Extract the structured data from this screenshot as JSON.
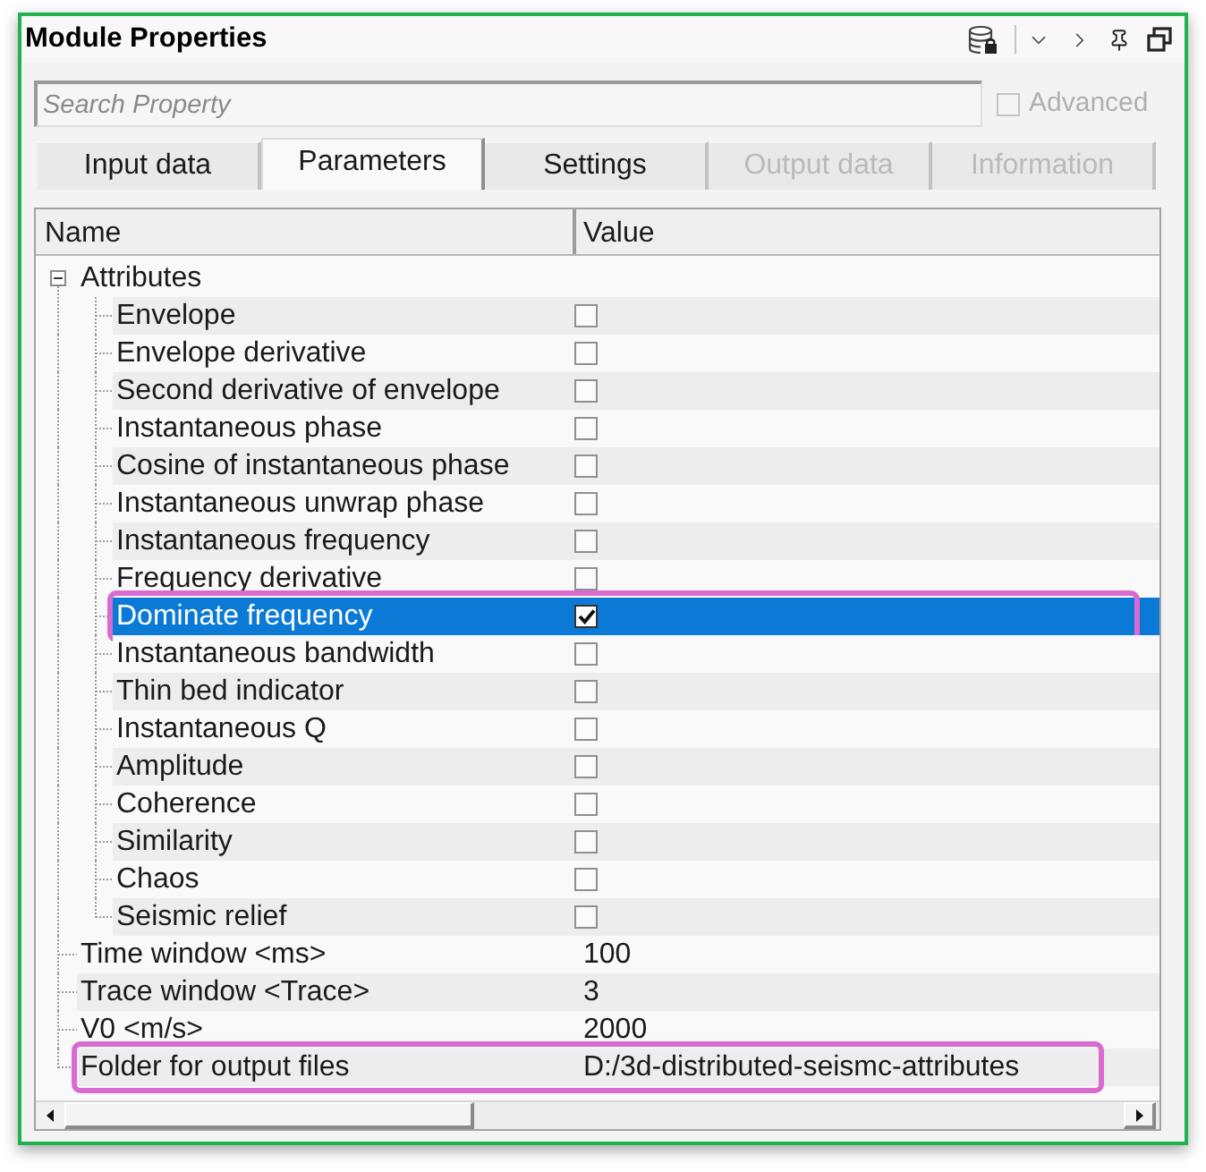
{
  "window": {
    "title": "Module Properties"
  },
  "search": {
    "placeholder": "Search Property"
  },
  "advanced": {
    "label": "Advanced",
    "checked": false,
    "disabled": true
  },
  "tabs": [
    {
      "label": "Input data",
      "selected": false,
      "disabled": false
    },
    {
      "label": "Parameters",
      "selected": true,
      "disabled": false
    },
    {
      "label": "Settings",
      "selected": false,
      "disabled": false
    },
    {
      "label": "Output data",
      "selected": false,
      "disabled": true
    },
    {
      "label": "Information",
      "selected": false,
      "disabled": true
    }
  ],
  "table": {
    "columns": [
      "Name",
      "Value"
    ],
    "rows": [
      {
        "name": "Attributes",
        "kind": "group",
        "expanded": true,
        "selected": false,
        "highlighted": false,
        "children": [
          {
            "name": "Envelope",
            "kind": "checkbox",
            "checked": false,
            "selected": false,
            "highlighted": false
          },
          {
            "name": "Envelope derivative",
            "kind": "checkbox",
            "checked": false,
            "selected": false,
            "highlighted": false
          },
          {
            "name": "Second derivative of envelope",
            "kind": "checkbox",
            "checked": false,
            "selected": false,
            "highlighted": false
          },
          {
            "name": "Instantaneous phase",
            "kind": "checkbox",
            "checked": false,
            "selected": false,
            "highlighted": false
          },
          {
            "name": "Cosine of instantaneous phase",
            "kind": "checkbox",
            "checked": false,
            "selected": false,
            "highlighted": false
          },
          {
            "name": "Instantaneous unwrap phase",
            "kind": "checkbox",
            "checked": false,
            "selected": false,
            "highlighted": false
          },
          {
            "name": "Instantaneous frequency",
            "kind": "checkbox",
            "checked": false,
            "selected": false,
            "highlighted": false
          },
          {
            "name": "Frequency derivative",
            "kind": "checkbox",
            "checked": false,
            "selected": false,
            "highlighted": false
          },
          {
            "name": "Dominate frequency",
            "kind": "checkbox",
            "checked": true,
            "selected": true,
            "highlighted": true
          },
          {
            "name": "Instantaneous bandwidth",
            "kind": "checkbox",
            "checked": false,
            "selected": false,
            "highlighted": false
          },
          {
            "name": "Thin bed indicator",
            "kind": "checkbox",
            "checked": false,
            "selected": false,
            "highlighted": false
          },
          {
            "name": "Instantaneous Q",
            "kind": "checkbox",
            "checked": false,
            "selected": false,
            "highlighted": false
          },
          {
            "name": "Amplitude",
            "kind": "checkbox",
            "checked": false,
            "selected": false,
            "highlighted": false
          },
          {
            "name": "Coherence",
            "kind": "checkbox",
            "checked": false,
            "selected": false,
            "highlighted": false
          },
          {
            "name": "Similarity",
            "kind": "checkbox",
            "checked": false,
            "selected": false,
            "highlighted": false
          },
          {
            "name": "Chaos",
            "kind": "checkbox",
            "checked": false,
            "selected": false,
            "highlighted": false
          },
          {
            "name": "Seismic relief",
            "kind": "checkbox",
            "checked": false,
            "selected": false,
            "highlighted": false
          }
        ]
      },
      {
        "name": "Time window <ms>",
        "kind": "text",
        "value": "100",
        "selected": false,
        "highlighted": false
      },
      {
        "name": "Trace window <Trace>",
        "kind": "text",
        "value": "3",
        "selected": false,
        "highlighted": false
      },
      {
        "name": "V0 <m/s>",
        "kind": "text",
        "value": "2000",
        "selected": false,
        "highlighted": false
      },
      {
        "name": "Folder for output files",
        "kind": "text",
        "value": "D:/3d-distributed-seismc-attributes",
        "selected": false,
        "highlighted": true
      }
    ]
  }
}
